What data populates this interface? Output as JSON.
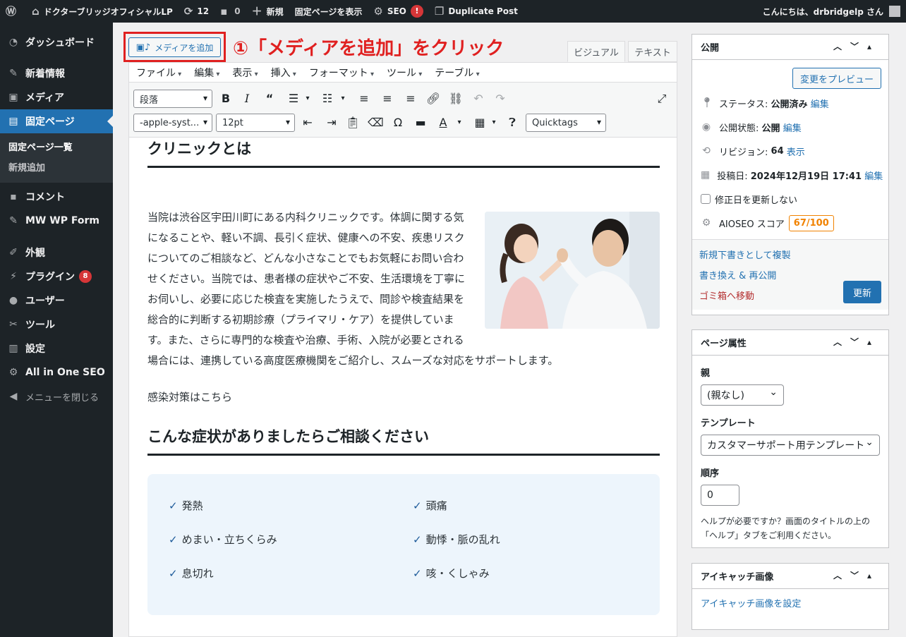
{
  "adminbar": {
    "site_name": "ドクターブリッジオフィシャルLP",
    "updates_count": "12",
    "comments_count": "0",
    "new_label": "新規",
    "view_page_label": "固定ページを表示",
    "seo_label": "SEO",
    "seo_alert": "!",
    "duplicate_label": "Duplicate Post",
    "greeting": "こんにちは、drbridgelp さん"
  },
  "sidebar": {
    "items": [
      {
        "label": "ダッシュボード",
        "icon": "dashboard-icon"
      },
      {
        "label": "新着情報",
        "icon": "pin-icon"
      },
      {
        "label": "メディア",
        "icon": "media-icon"
      },
      {
        "label": "固定ページ",
        "icon": "pages-icon"
      },
      {
        "label": "コメント",
        "icon": "comment-icon"
      },
      {
        "label": "MW WP Form",
        "icon": "pin-icon"
      },
      {
        "label": "外観",
        "icon": "appearance-icon"
      },
      {
        "label": "プラグイン",
        "icon": "plugin-icon",
        "badge": "8"
      },
      {
        "label": "ユーザー",
        "icon": "user-icon"
      },
      {
        "label": "ツール",
        "icon": "tool-icon"
      },
      {
        "label": "設定",
        "icon": "settings-icon"
      },
      {
        "label": "All in One SEO",
        "icon": "aioseo-icon"
      },
      {
        "label": "メニューを閉じる",
        "icon": "collapse-icon"
      }
    ],
    "submenu": [
      "固定ページ一覧",
      "新規追加"
    ]
  },
  "editor": {
    "add_media_label": "メディアを追加",
    "annotation": "①「メディアを追加」をクリック",
    "tab_visual": "ビジュアル",
    "tab_text": "テキスト",
    "menus": [
      "ファイル",
      "編集",
      "表示",
      "挿入",
      "フォーマット",
      "ツール",
      "テーブル"
    ],
    "format_select": "段落",
    "font_select": "-apple-syst...",
    "size_select": "12pt",
    "quicktags_select": "Quicktags"
  },
  "content": {
    "heading1": "クリニックとは",
    "paragraph": "当院は渋谷区宇田川町にある内科クリニックです。体調に関する気になることや、軽い不調、長引く症状、健康への不安、疾患リスクについてのご相談など、どんな小さなことでもお気軽にお問い合わせください。当院では、患者様の症状やご不安、生活環境を丁寧にお伺いし、必要に応じた検査を実施したうえで、問診や検査結果を総合的に判断する初期診療（プライマリ・ケア）を提供しています。また、さらに専門的な検査や治療、手術、入院が必要とされる場合には、連携している高度医療機関をご紹介し、スムーズな対応をサポートします。",
    "infection_link": "感染対策はこちら",
    "heading2": "こんな症状がありましたらご相談ください",
    "symptoms": [
      "発熱",
      "頭痛",
      "めまい・立ちくらみ",
      "動悸・脈の乱れ",
      "息切れ",
      "咳・くしゃみ"
    ]
  },
  "publish": {
    "title": "公開",
    "preview_label": "変更をプレビュー",
    "status_label": "ステータス:",
    "status_value": "公開済み",
    "visibility_label": "公開状態:",
    "visibility_value": "公開",
    "revision_label": "リビジョン:",
    "revision_value": "64",
    "revision_link": "表示",
    "date_label": "投稿日:",
    "date_value": "2024年12月19日 17:41",
    "edit_link": "編集",
    "no_update_label": "修正日を更新しない",
    "aioseo_label": "AIOSEO スコア",
    "aioseo_score": "67/100",
    "copy_draft": "新規下書きとして複製",
    "rewrite_republish": "書き換え & 再公開",
    "trash": "ゴミ箱へ移動",
    "update_label": "更新"
  },
  "page_attributes": {
    "title": "ページ属性",
    "parent_label": "親",
    "parent_value": "(親なし)",
    "template_label": "テンプレート",
    "template_value": "カスタマーサポート用テンプレート",
    "order_label": "順序",
    "order_value": "0",
    "help": "ヘルプが必要ですか？画面のタイトルの上の「ヘルプ」タブをご利用ください。"
  },
  "featured_image": {
    "title": "アイキャッチ画像",
    "set_link": "アイキャッチ画像を設定"
  },
  "colors": {
    "accent": "#2271b1",
    "annotation": "#e02020",
    "sidebar_bg": "#1d2327",
    "aioseo_score": "#f18200"
  }
}
